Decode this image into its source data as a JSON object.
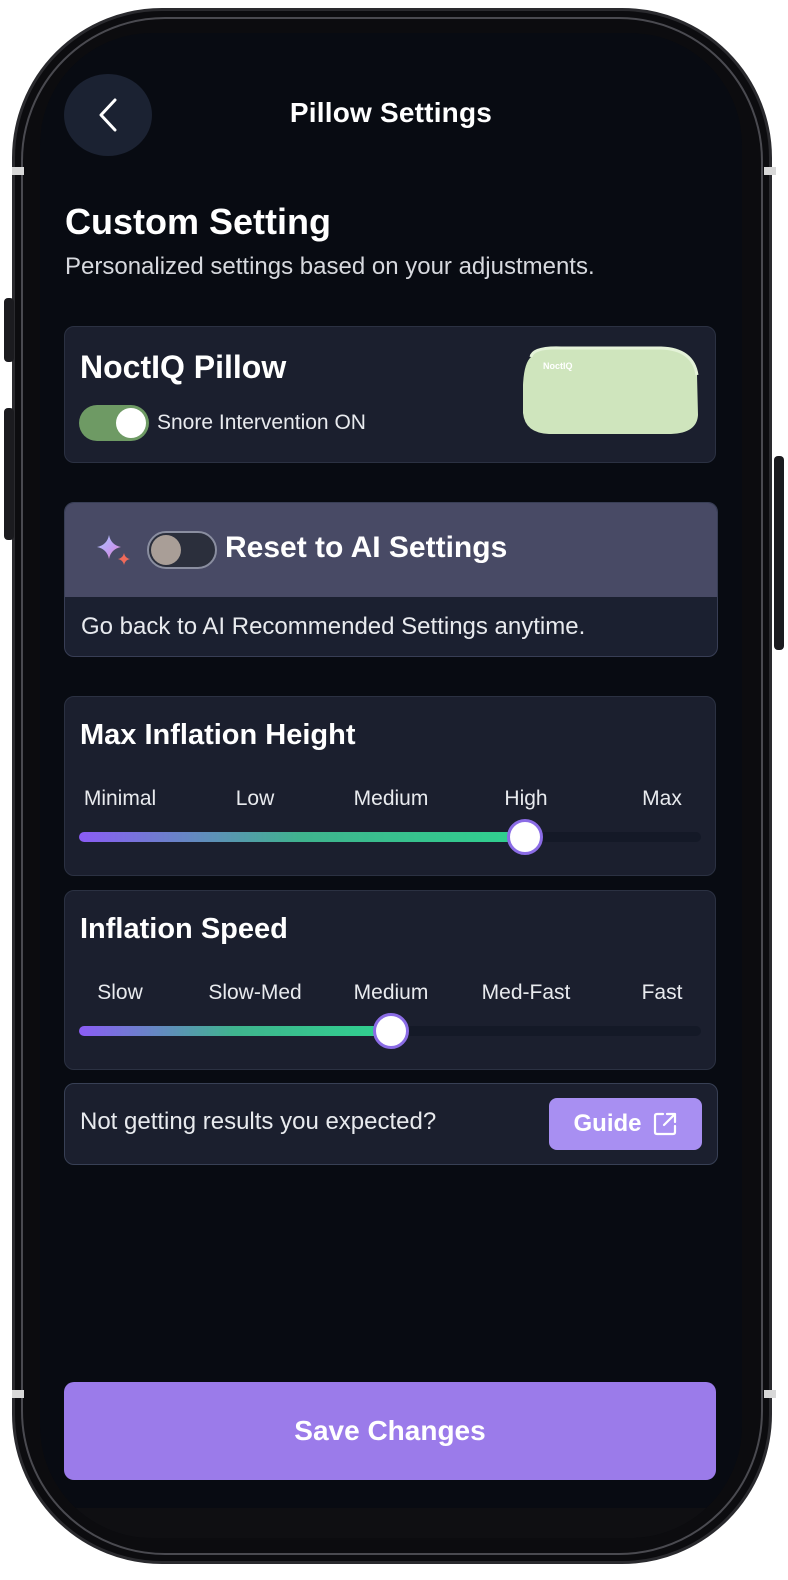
{
  "header": {
    "title": "Pillow Settings"
  },
  "section": {
    "title": "Custom Setting",
    "subtitle": "Personalized settings based on your adjustments."
  },
  "device": {
    "name": "NoctIQ Pillow",
    "toggle_label": "Snore Intervention ON",
    "toggle_on": true,
    "image_brand": "NoctIQ",
    "image_color": "#cfe5bd"
  },
  "ai_reset": {
    "title": "Reset to AI Settings",
    "description": "Go back to AI Recommended Settings anytime.",
    "toggle_on": false,
    "icon": "sparkle-icon"
  },
  "max_inflation": {
    "title": "Max Inflation Height",
    "levels": [
      "Minimal",
      "Low",
      "Medium",
      "High",
      "Max"
    ],
    "selected": "High"
  },
  "inflation_speed": {
    "title": "Inflation Speed",
    "levels": [
      "Slow",
      "Slow-Med",
      "Medium",
      "Med-Fast",
      "Fast"
    ],
    "selected": "Medium"
  },
  "help": {
    "text": "Not getting results you expected?",
    "button_label": "Guide",
    "button_icon": "external-link-icon"
  },
  "footer": {
    "save_label": "Save Changes"
  },
  "colors": {
    "background": "#080b12",
    "card": "#1b1f2e",
    "accent": "#9b7bea",
    "toggle_on": "#6e9a64"
  }
}
